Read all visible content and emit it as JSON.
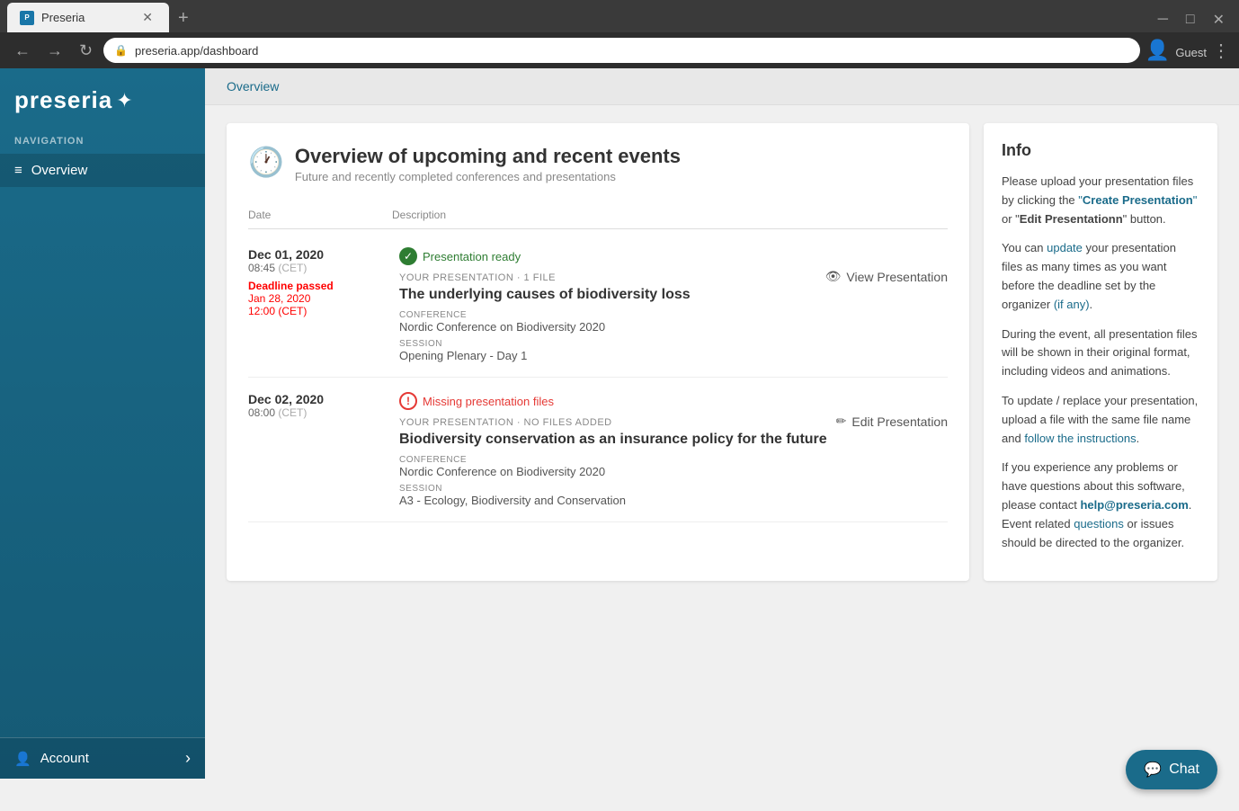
{
  "browser": {
    "tab_title": "Preseria",
    "tab_favicon": "P",
    "url": "preseria.app/dashboard",
    "new_tab_label": "+",
    "back_label": "←",
    "forward_label": "→",
    "refresh_label": "↻",
    "profile_label": "Guest",
    "minimize_label": "─",
    "maximize_label": "□",
    "close_label": "✕"
  },
  "sidebar": {
    "logo_text": "preseria",
    "nav_label": "NAVIGATION",
    "items": [
      {
        "id": "overview",
        "label": "Overview",
        "icon": "≡"
      }
    ],
    "account_label": "Account",
    "account_icon": "👤",
    "chevron": "›"
  },
  "breadcrumb": "Overview",
  "overview": {
    "icon": "🕐",
    "title": "Overview of upcoming and recent events",
    "subtitle": "Future and recently completed conferences and presentations",
    "col_date": "Date",
    "col_description": "Description",
    "events": [
      {
        "date_main": "Dec 01, 2020",
        "time": "08:45",
        "time_zone": "(CET)",
        "deadline_label": "Deadline passed",
        "deadline_date": "Jan 28, 2020",
        "deadline_time": "12:00",
        "deadline_tz": "(CET)",
        "status": "ready",
        "status_text": "Presentation ready",
        "meta": "YOUR PRESENTATION · 1 FILE",
        "title": "The underlying causes of biodiversity loss",
        "conference_label": "CONFERENCE",
        "conference": "Nordic Conference on Biodiversity 2020",
        "session_label": "SESSION",
        "session": "Opening Plenary - Day 1",
        "action_label": "View Presentation",
        "action_icon": "👁"
      },
      {
        "date_main": "Dec 02, 2020",
        "time": "08:00",
        "time_zone": "(CET)",
        "deadline_label": "",
        "deadline_date": "",
        "deadline_time": "",
        "deadline_tz": "",
        "status": "missing",
        "status_text": "Missing presentation files",
        "meta": "YOUR PRESENTATION · NO FILES ADDED",
        "title": "Biodiversity conservation as an insurance policy for the future",
        "conference_label": "CONFERENCE",
        "conference": "Nordic Conference on Biodiversity 2020",
        "session_label": "SESSION",
        "session": "A3 - Ecology, Biodiversity and Conservation",
        "action_label": "Edit Presentation",
        "action_icon": "✏"
      }
    ]
  },
  "info": {
    "title": "Info",
    "paragraphs": [
      {
        "text": "Please upload your presentation files by clicking the \"Create Presentation\" or \"Edit Presentationn\" button."
      },
      {
        "text": "You can update your presentation files as many times as you want before the deadline set by the organizer (if any)."
      },
      {
        "text": "During the event, all presentation files will be shown in their original format, including videos and animations."
      },
      {
        "text": "To update / replace your presentation, upload a file with the same file name and follow the instructions."
      },
      {
        "text": "If you experience any problems or have questions about this software, please contact help@preseria.com. Event related questions or issues should be directed to the organizer."
      }
    ]
  },
  "chat": {
    "label": "Chat",
    "icon": "💬"
  }
}
